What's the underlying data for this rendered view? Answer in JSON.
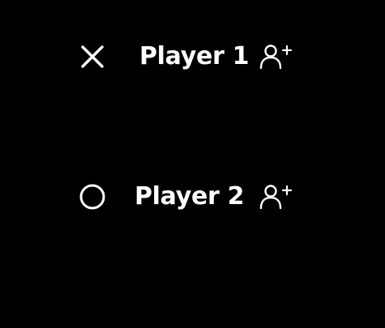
{
  "players": [
    {
      "name": "Player 1",
      "symbol_icon": "cross-icon",
      "add_icon": "add-user-icon"
    },
    {
      "name": "Player 2",
      "symbol_icon": "circle-icon",
      "add_icon": "add-user-icon"
    }
  ],
  "colors": {
    "background": "#000000",
    "foreground": "#ffffff"
  }
}
